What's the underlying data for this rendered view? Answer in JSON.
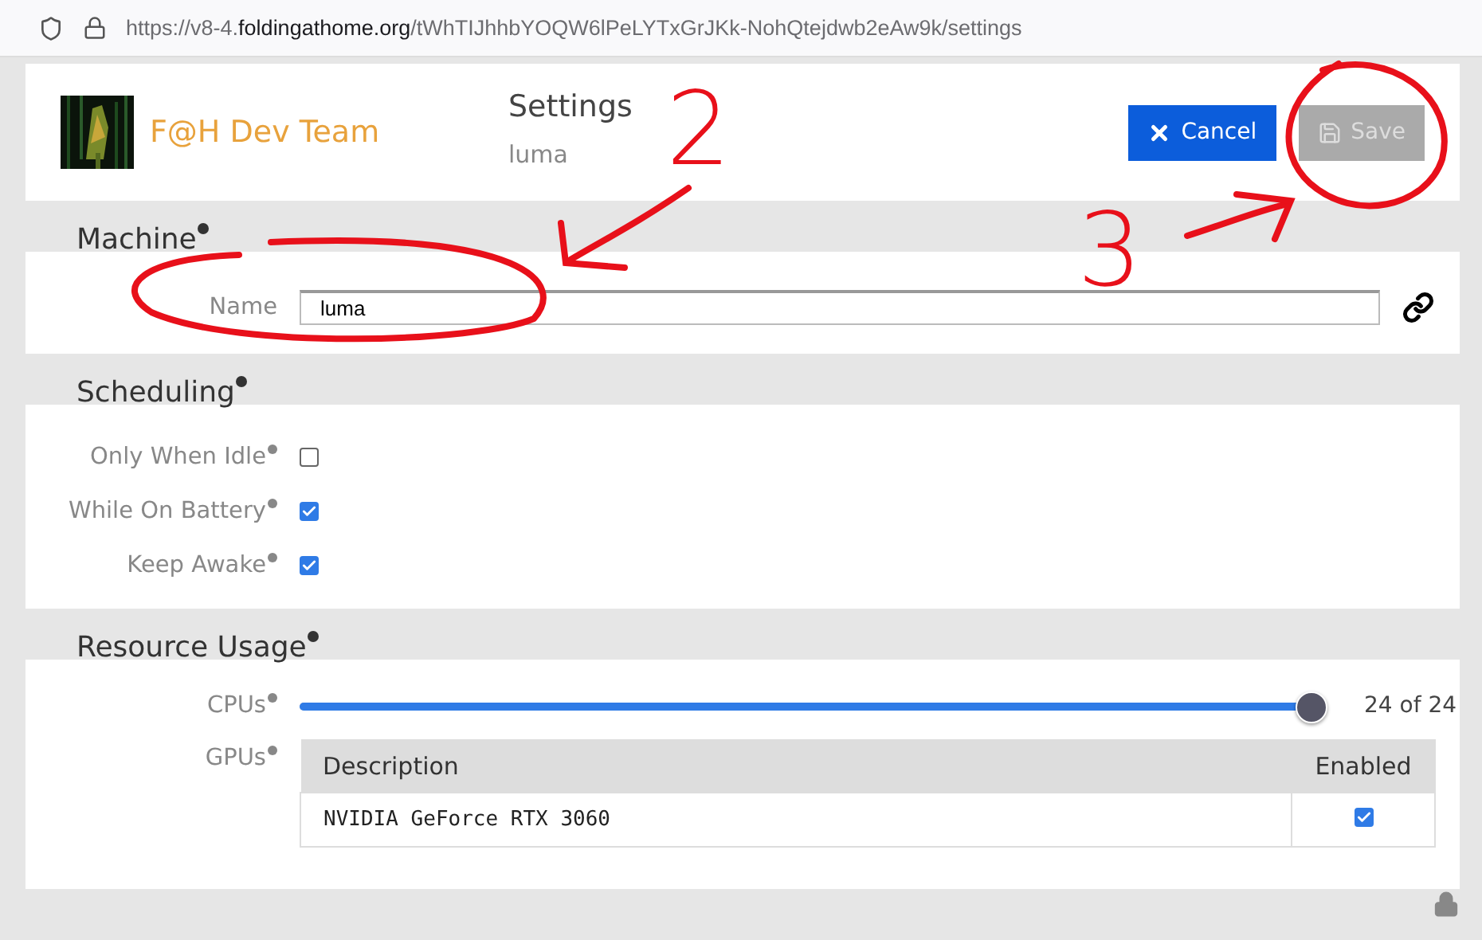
{
  "browser": {
    "url": "https://v8-4.**foldingathome.org**/tWhTIJhhbYOQW6lPeLYTxGrJKk-NohQtejdwb2eAw9k/settings"
  },
  "header": {
    "team": "F@H Dev Team",
    "title": "Settings",
    "subtitle": "luma",
    "buttons": [
      {
        "kind": "cancel",
        "label": "Cancel",
        "disabled": false
      },
      {
        "kind": "save",
        "label": "Save",
        "disabled": true
      }
    ]
  },
  "machine": {
    "heading": "Machine",
    "name_label": "Name",
    "name_value": "luma"
  },
  "scheduling": {
    "heading": "Scheduling",
    "options": [
      {
        "label": "Only When Idle",
        "checked": false
      },
      {
        "label": "While On Battery",
        "checked": true
      },
      {
        "label": "Keep Awake",
        "checked": true
      }
    ]
  },
  "resources": {
    "heading": "Resource Usage",
    "cpus_label": "CPUs",
    "cpus": {
      "level": 1,
      "reading": "24 of 24"
    },
    "gpus_label": "GPUs",
    "gpu_table": {
      "columns": [
        "Description",
        "Enabled"
      ],
      "rows": [
        {
          "description": "NVIDIA GeForce RTX 3060",
          "enabled": true
        }
      ]
    }
  },
  "annotations": [
    {
      "kind": "number",
      "label": "2"
    },
    {
      "kind": "ellipse"
    },
    {
      "kind": "arrow"
    },
    {
      "kind": "number",
      "label": "3"
    },
    {
      "kind": "arrow"
    },
    {
      "kind": "ellipse"
    }
  ]
}
